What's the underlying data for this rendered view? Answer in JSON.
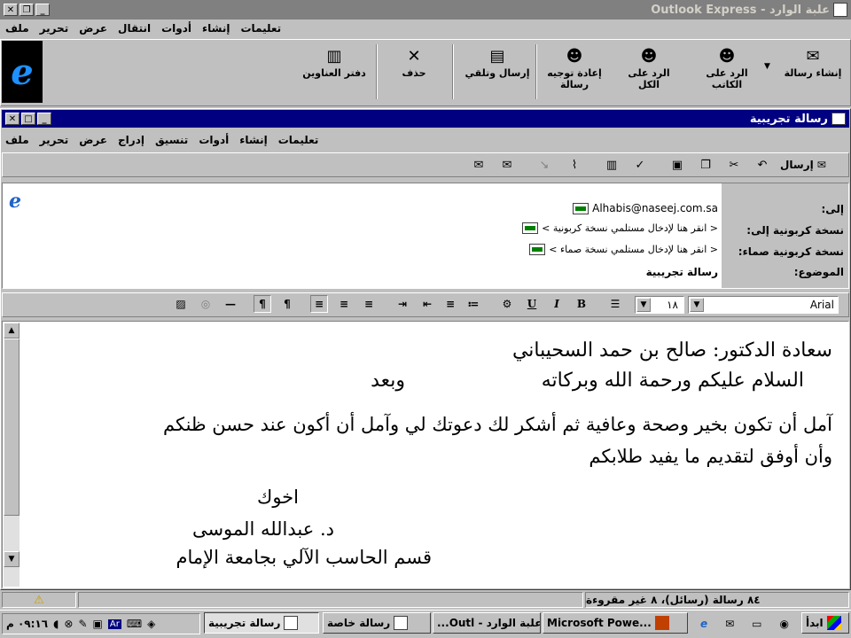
{
  "main_window": {
    "title": "علبة الوارد - Outlook Express",
    "menus": [
      "ملف",
      "تحرير",
      "عرض",
      "انتقال",
      "أدوات",
      "إنشاء",
      "تعليمات"
    ],
    "toolbar": [
      {
        "label": "إنشاء رسالة",
        "icon": "new-message-icon"
      },
      {
        "label": "الرد على الكاتب",
        "icon": "reply-author-icon"
      },
      {
        "label": "الرد على الكل",
        "icon": "reply-all-icon"
      },
      {
        "label": "إعادة توجيه رسالة",
        "icon": "forward-icon"
      },
      {
        "label": "إرسال وتلقي",
        "icon": "send-receive-icon"
      },
      {
        "label": "حذف",
        "icon": "delete-icon"
      },
      {
        "label": "دفتر العناوين",
        "icon": "address-book-icon"
      }
    ]
  },
  "compose": {
    "title": "رسالة تجريبية",
    "menus": [
      "ملف",
      "تحرير",
      "عرض",
      "إدراج",
      "تنسيق",
      "أدوات",
      "إنشاء",
      "تعليمات"
    ],
    "send_label": "إرسال",
    "to_label": "إلى:",
    "to_value": "Alhabis@naseej.com.sa",
    "cc_label": "نسخة كربونية إلى:",
    "cc_placeholder": "< انقر هنا لإدخال مستلمي نسخة كربونية >",
    "bcc_label": "نسخة كربونية صماء:",
    "bcc_placeholder": "< انقر هنا لإدخال مستلمي نسخة صماء >",
    "subject_label": "الموضوع:",
    "subject_value": "رسالة تجريبية",
    "font_name": "Arial",
    "font_size": "١٨",
    "body": [
      "سعادة الدكتور: صالح بن حمد السحيباني",
      "السلام عليكم ورحمة الله وبركاته",
      "وبعد",
      "آمل أن تكون بخير وصحة وعافية ثم أشكر لك دعوتك لي وآمل أن أكون عند حسن ظنكم",
      "وأن أوفق لتقديم ما يفيد طلابكم",
      "اخوك",
      "د. عبدالله الموسى",
      "قسم الحاسب الآلي بجامعة الإمام"
    ]
  },
  "status_bar": {
    "text": "٨٤ رسالة (رسائل)، ٨ غير مقروءة"
  },
  "taskbar": {
    "start_label": "ابدأ",
    "clock": "٠٩:١٦ م",
    "buttons": [
      {
        "label": "Microsoft Powe...",
        "active": false
      },
      {
        "label": "علبة الوارد - Outl...",
        "active": false
      },
      {
        "label": "رسالة خاصة",
        "active": false
      },
      {
        "label": "رسالة تجريبية",
        "active": true
      }
    ]
  }
}
